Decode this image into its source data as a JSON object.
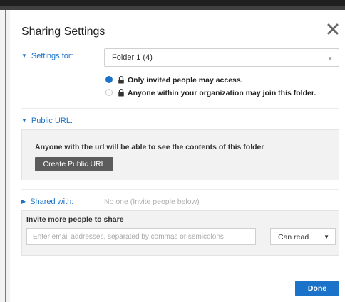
{
  "dialog": {
    "title": "Sharing Settings",
    "close_icon": "close-icon"
  },
  "settings_for": {
    "label": "Settings for:",
    "selected_folder": "Folder 1 (4)",
    "access_options": [
      {
        "label": "Only invited people may access.",
        "selected": true
      },
      {
        "label": "Anyone within your organization may join this folder.",
        "selected": false
      }
    ]
  },
  "public_url": {
    "label": "Public URL:",
    "description": "Anyone with the url will be able to see the contents of this folder",
    "create_button": "Create Public URL"
  },
  "shared_with": {
    "label": "Shared with:",
    "value": "No one (Invite people below)"
  },
  "invite": {
    "title": "Invite more people to share",
    "placeholder": "Enter email addresses, separated by commas or semicolons",
    "permission": "Can read"
  },
  "footer": {
    "done_button": "Done"
  },
  "colors": {
    "accent": "#1a73c8",
    "button_dark": "#5c5c5c",
    "panel_bg": "#f2f2f2"
  }
}
